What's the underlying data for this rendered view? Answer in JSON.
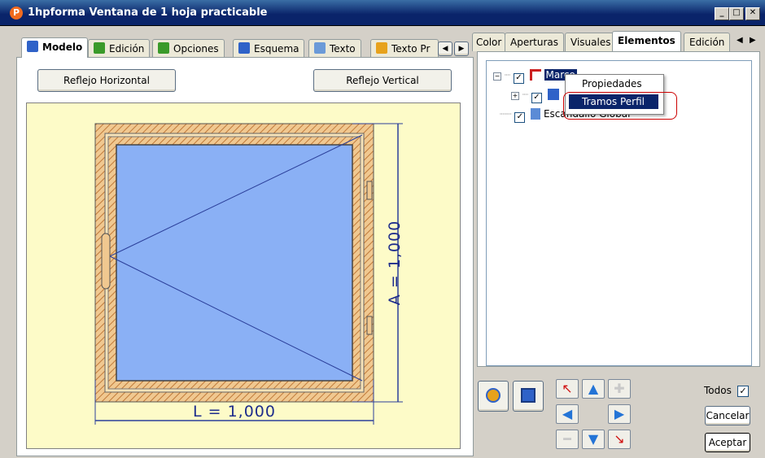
{
  "window": {
    "title": "1hpforma Ventana de 1 hoja practicable",
    "app_icon_letter": "P",
    "minimize": "_",
    "maximize": "□",
    "close": "✕"
  },
  "left_tabs": [
    {
      "label": "Modelo",
      "active": true
    },
    {
      "label": "Edición"
    },
    {
      "label": "Opciones"
    },
    {
      "label": "Esquema"
    },
    {
      "label": "Texto"
    },
    {
      "label": "Texto Pr"
    }
  ],
  "left_scroll": {
    "left": "◀",
    "right": "▶"
  },
  "buttons": {
    "mirror_h": "Reflejo Horizontal",
    "mirror_v": "Reflejo Vertical"
  },
  "drawing": {
    "width_label": "L = 1,000",
    "height_label": "A = 1,000"
  },
  "right_tabs": [
    {
      "label": "Color"
    },
    {
      "label": "Aperturas"
    },
    {
      "label": "Visuales"
    },
    {
      "label": "Elementos",
      "active": true
    },
    {
      "label": "Edición"
    }
  ],
  "right_scroll": {
    "left": "◀",
    "right": "▶"
  },
  "tree": {
    "marco": "Marco",
    "escandallo": "Escandallo Global",
    "check": "✓",
    "expand_minus": "−",
    "expand_plus": "+"
  },
  "context_menu": {
    "items": [
      "Propiedades",
      "Tramos Perfil"
    ],
    "highlighted": "Tramos Perfil"
  },
  "bottom": {
    "todos_label": "Todos",
    "todos_checked": "✓",
    "cancel": "Cancelar",
    "accept": "Aceptar"
  },
  "colors": {
    "title_bar": "#0a246a",
    "drawing_bg": "#fdfbc8",
    "glass": "#8ab0f5",
    "frame": "#f0c890",
    "highlight": "#0a246a",
    "callout": "#cc0000"
  }
}
